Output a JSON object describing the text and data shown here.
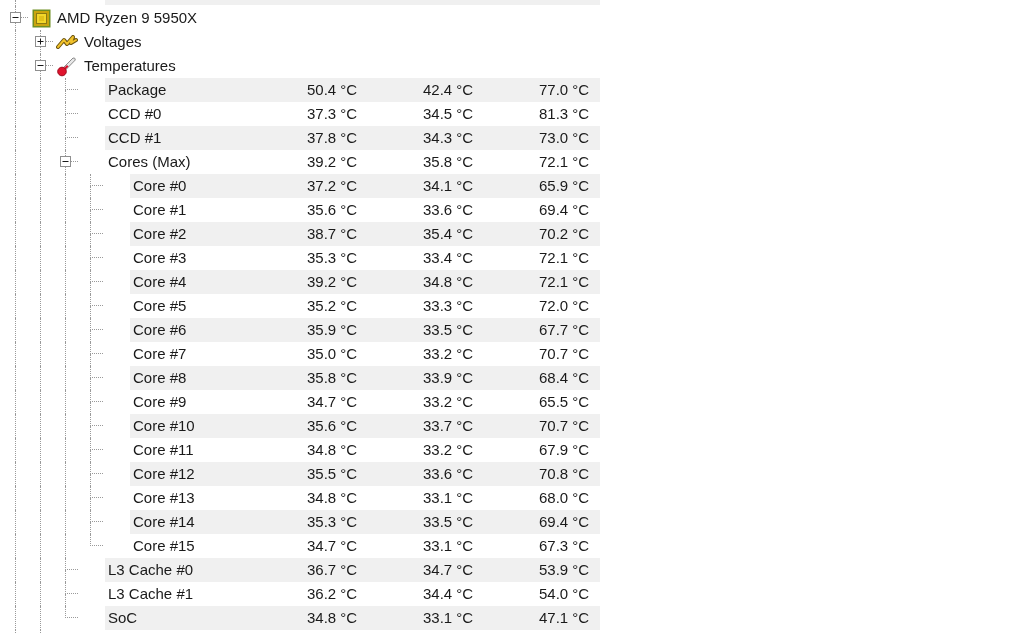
{
  "sensor_tree": {
    "items": [
      {
        "label": "AMD Ryzen 9 5950X",
        "kind": "cpu",
        "expanded": true,
        "children": [
          {
            "label": "Voltages",
            "kind": "voltage",
            "expanded": false
          },
          {
            "label": "Temperatures",
            "kind": "temperature",
            "expanded": true,
            "children": [
              {
                "label": "Package",
                "values": [
                  "50.4 °C",
                  "42.4 °C",
                  "77.0 °C"
                ]
              },
              {
                "label": "CCD #0",
                "values": [
                  "37.3 °C",
                  "34.5 °C",
                  "81.3 °C"
                ]
              },
              {
                "label": "CCD #1",
                "values": [
                  "37.8 °C",
                  "34.3 °C",
                  "73.0 °C"
                ]
              },
              {
                "label": "Cores (Max)",
                "values": [
                  "39.2 °C",
                  "35.8 °C",
                  "72.1 °C"
                ],
                "expanded": true,
                "children": [
                  {
                    "label": "Core #0",
                    "values": [
                      "37.2 °C",
                      "34.1 °C",
                      "65.9 °C"
                    ]
                  },
                  {
                    "label": "Core #1",
                    "values": [
                      "35.6 °C",
                      "33.6 °C",
                      "69.4 °C"
                    ]
                  },
                  {
                    "label": "Core #2",
                    "values": [
                      "38.7 °C",
                      "35.4 °C",
                      "70.2 °C"
                    ]
                  },
                  {
                    "label": "Core #3",
                    "values": [
                      "35.3 °C",
                      "33.4 °C",
                      "72.1 °C"
                    ]
                  },
                  {
                    "label": "Core #4",
                    "values": [
                      "39.2 °C",
                      "34.8 °C",
                      "72.1 °C"
                    ]
                  },
                  {
                    "label": "Core #5",
                    "values": [
                      "35.2 °C",
                      "33.3 °C",
                      "72.0 °C"
                    ]
                  },
                  {
                    "label": "Core #6",
                    "values": [
                      "35.9 °C",
                      "33.5 °C",
                      "67.7 °C"
                    ]
                  },
                  {
                    "label": "Core #7",
                    "values": [
                      "35.0 °C",
                      "33.2 °C",
                      "70.7 °C"
                    ]
                  },
                  {
                    "label": "Core #8",
                    "values": [
                      "35.8 °C",
                      "33.9 °C",
                      "68.4 °C"
                    ]
                  },
                  {
                    "label": "Core #9",
                    "values": [
                      "34.7 °C",
                      "33.2 °C",
                      "65.5 °C"
                    ]
                  },
                  {
                    "label": "Core #10",
                    "values": [
                      "35.6 °C",
                      "33.7 °C",
                      "70.7 °C"
                    ]
                  },
                  {
                    "label": "Core #11",
                    "values": [
                      "34.8 °C",
                      "33.2 °C",
                      "67.9 °C"
                    ]
                  },
                  {
                    "label": "Core #12",
                    "values": [
                      "35.5 °C",
                      "33.6 °C",
                      "70.8 °C"
                    ]
                  },
                  {
                    "label": "Core #13",
                    "values": [
                      "34.8 °C",
                      "33.1 °C",
                      "68.0 °C"
                    ]
                  },
                  {
                    "label": "Core #14",
                    "values": [
                      "35.3 °C",
                      "33.5 °C",
                      "69.4 °C"
                    ]
                  },
                  {
                    "label": "Core #15",
                    "values": [
                      "34.7 °C",
                      "33.1 °C",
                      "67.3 °C"
                    ]
                  }
                ]
              },
              {
                "label": "L3 Cache #0",
                "values": [
                  "36.7 °C",
                  "34.7 °C",
                  "53.9 °C"
                ]
              },
              {
                "label": "L3 Cache #1",
                "values": [
                  "36.2 °C",
                  "34.4 °C",
                  "54.0 °C"
                ]
              },
              {
                "label": "SoC",
                "values": [
                  "34.8 °C",
                  "33.1 °C",
                  "47.1 °C"
                ]
              }
            ]
          }
        ]
      }
    ]
  }
}
